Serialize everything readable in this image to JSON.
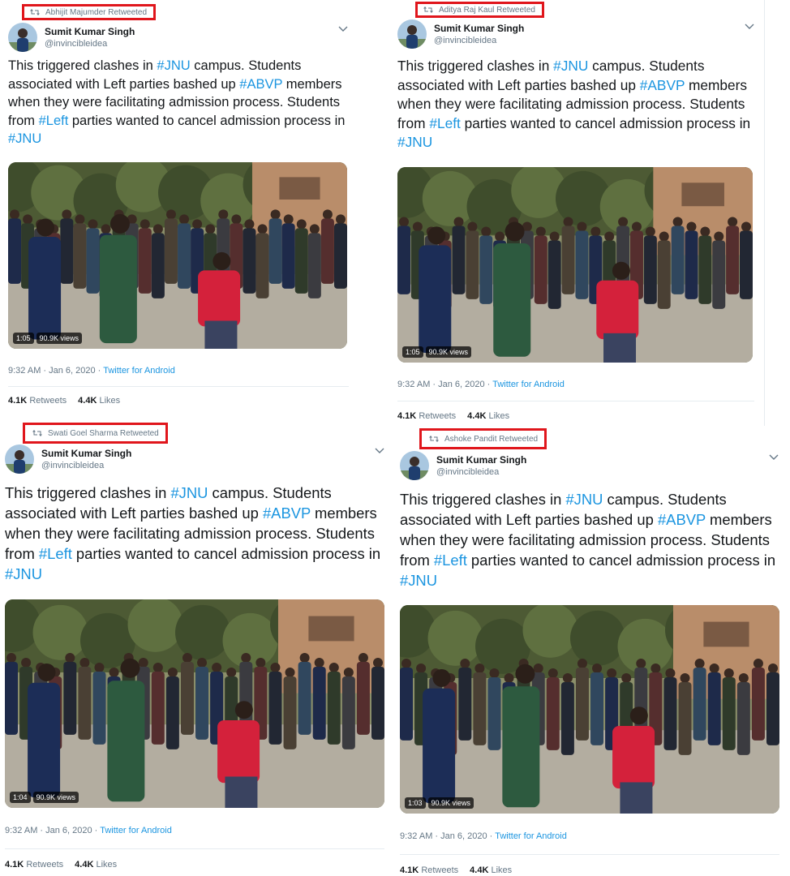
{
  "tweets": [
    {
      "retweeted_by": "Abhijit Majumder Retweeted",
      "user_name": "Sumit Kumar Singh",
      "handle": "@invincibleidea",
      "text_1": "This triggered clashes in ",
      "tag_1": "#JNU",
      "text_2": " campus. Students associated with Left parties bashed up ",
      "tag_2": "#ABVP",
      "text_3": " members when they were facilitating admission process. Students from ",
      "tag_3": "#Left",
      "text_4": " parties wanted to cancel admission process in ",
      "tag_4": "#JNU",
      "duration": "1:05",
      "views": "90.9K views",
      "timestamp": "9:32 AM · Jan 6, 2020 · ",
      "source": "Twitter for Android",
      "retweet_count": "4.1K",
      "retweet_label": "Retweets",
      "like_count": "4.4K",
      "like_label": "Likes"
    },
    {
      "retweeted_by": "Aditya Raj Kaul Retweeted",
      "user_name": "Sumit Kumar Singh",
      "handle": "@invincibleidea",
      "text_1": "This triggered clashes in ",
      "tag_1": "#JNU",
      "text_2": " campus. Students associated with Left parties bashed up ",
      "tag_2": "#ABVP",
      "text_3": " members when they were facilitating admission process. Students from ",
      "tag_3": "#Left",
      "text_4": " parties wanted to cancel admission process in ",
      "tag_4": "#JNU",
      "duration": "1:05",
      "views": "90.9K views",
      "timestamp": "9:32 AM · Jan 6, 2020 · ",
      "source": "Twitter for Android",
      "retweet_count": "4.1K",
      "retweet_label": "Retweets",
      "like_count": "4.4K",
      "like_label": "Likes"
    },
    {
      "retweeted_by": "Swati Goel Sharma Retweeted",
      "user_name": "Sumit Kumar Singh",
      "handle": "@invincibleidea",
      "text_1": "This triggered clashes in ",
      "tag_1": "#JNU",
      "text_2": " campus. Students associated with Left parties bashed up ",
      "tag_2": "#ABVP",
      "text_3": " members when they were facilitating admission process. Students from ",
      "tag_3": "#Left",
      "text_4": " parties wanted to cancel admission process in ",
      "tag_4": "#JNU",
      "duration": "1:04",
      "views": "90.9K views",
      "timestamp": "9:32 AM · Jan 6, 2020 · ",
      "source": "Twitter for Android",
      "retweet_count": "4.1K",
      "retweet_label": "Retweets",
      "like_count": "4.4K",
      "like_label": "Likes"
    },
    {
      "retweeted_by": "Ashoke Pandit Retweeted",
      "user_name": "Sumit Kumar Singh",
      "handle": "@invincibleidea",
      "text_1": "This triggered clashes in ",
      "tag_1": "#JNU",
      "text_2": " campus. Students associated with Left parties bashed up ",
      "tag_2": "#ABVP",
      "text_3": " members when they were facilitating admission process. Students from ",
      "tag_3": "#Left",
      "text_4": " parties wanted to cancel admission process in ",
      "tag_4": "#JNU",
      "duration": "1:03",
      "views": "90.9K views",
      "timestamp": "9:32 AM · Jan 6, 2020 · ",
      "source": "Twitter for Android",
      "retweet_count": "4.1K",
      "retweet_label": "Retweets",
      "like_count": "4.4K",
      "like_label": "Likes"
    }
  ],
  "colors": {
    "hashtag": "#1b95e0",
    "highlight_box": "#e0161c",
    "muted": "#657786"
  },
  "icons": {
    "retweet": "retweet-icon",
    "caret": "chevron-down-icon"
  }
}
